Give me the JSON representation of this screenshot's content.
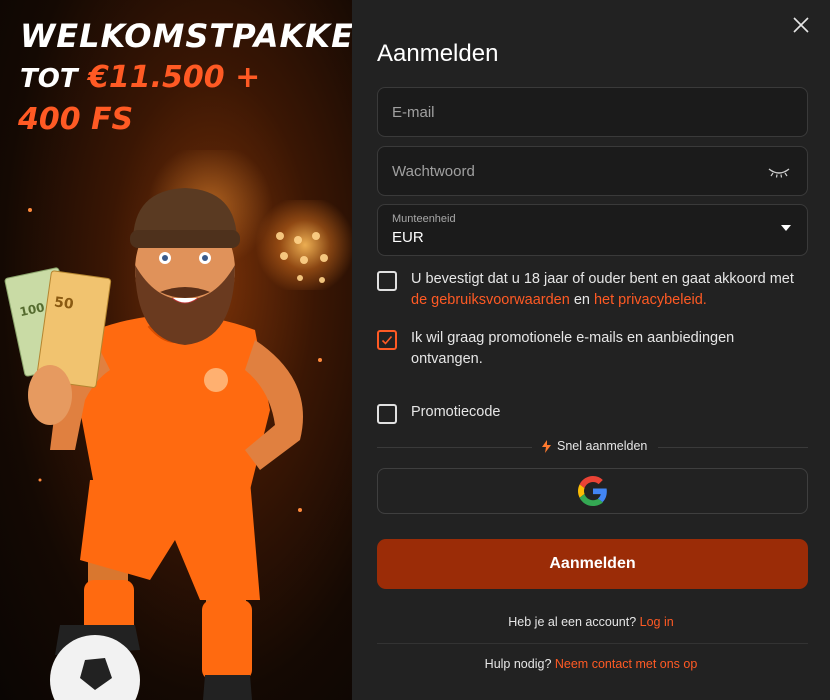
{
  "promo": {
    "title": "WELKOMSTPAKKET",
    "line1_prefix": "TOT",
    "line1_amount": "€11.500 +",
    "line2": "400 FS",
    "banknote_small": "100",
    "banknote_large": "50"
  },
  "form": {
    "title": "Aanmelden",
    "email_placeholder": "E-mail",
    "password_placeholder": "Wachtwoord",
    "currency_label": "Munteenheid",
    "currency_value": "EUR",
    "age_terms": {
      "text_before": "U bevestigt dat u 18 jaar of ouder bent en gaat akkoord met ",
      "terms_link": "de gebruiksvoorwaarden",
      "text_middle": " en ",
      "privacy_link": "het privacybeleid.",
      "checked": false
    },
    "promo_emails": {
      "label": "Ik wil graag promotionele e-mails en aanbiedingen ontvangen.",
      "checked": true
    },
    "promo_code": {
      "label": "Promotiecode",
      "checked": false
    },
    "fast_signup_label": "Snel aanmelden",
    "submit_label": "Aanmelden",
    "have_account_text": "Heb je al een account?",
    "login_link": "Log in",
    "help_text": "Hulp nodig?",
    "contact_link": "Neem contact met ons op"
  },
  "colors": {
    "accent": "#ff5a24",
    "submit_bg": "#9b2c07",
    "panel_bg": "#222222",
    "field_bg": "#1b1b1b"
  },
  "icons": [
    "close-icon",
    "eye-closed-icon",
    "chevron-down-icon",
    "checkmark-icon",
    "lightning-icon",
    "google-icon"
  ]
}
